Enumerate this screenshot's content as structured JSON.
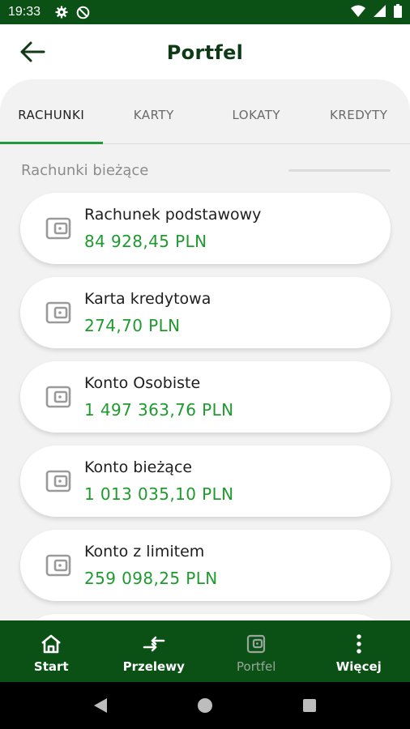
{
  "status_bar": {
    "time": "19:33",
    "icons": [
      "settings-icon",
      "blocked-icon",
      "wifi-icon",
      "signal-icon",
      "battery-icon"
    ]
  },
  "header": {
    "title": "Portfel",
    "back_icon": "arrow-left-icon"
  },
  "tabs": [
    {
      "label": "RACHUNKI",
      "active": true
    },
    {
      "label": "KARTY",
      "active": false
    },
    {
      "label": "LOKATY",
      "active": false
    },
    {
      "label": "KREDYTY",
      "active": false
    }
  ],
  "section": {
    "title": "Rachunki bieżące"
  },
  "accounts": [
    {
      "name": "Rachunek podstawowy",
      "amount": "84 928,45 PLN",
      "icon": "wallet-icon"
    },
    {
      "name": "Karta kredytowa",
      "amount": "274,70 PLN",
      "icon": "wallet-icon"
    },
    {
      "name": "Konto Osobiste",
      "amount": "1 497 363,76 PLN",
      "icon": "wallet-icon"
    },
    {
      "name": "Konto bieżące",
      "amount": "1 013 035,10 PLN",
      "icon": "wallet-icon"
    },
    {
      "name": "Konto z limitem",
      "amount": "259 098,25 PLN",
      "icon": "wallet-icon"
    }
  ],
  "bottom_nav": [
    {
      "label": "Start",
      "icon": "home-icon",
      "active": false
    },
    {
      "label": "Przelewy",
      "icon": "transfer-icon",
      "active": false
    },
    {
      "label": "Portfel",
      "icon": "wallet-icon",
      "active": true
    },
    {
      "label": "Więcej",
      "icon": "more-vertical-icon",
      "active": false
    }
  ],
  "system_nav": [
    "back-triangle-icon",
    "home-circle-icon",
    "recents-square-icon"
  ],
  "colors": {
    "brand_dark_green": "#0b5116",
    "amount_green": "#1e9a2e",
    "tab_indicator": "#1f9a3c"
  }
}
